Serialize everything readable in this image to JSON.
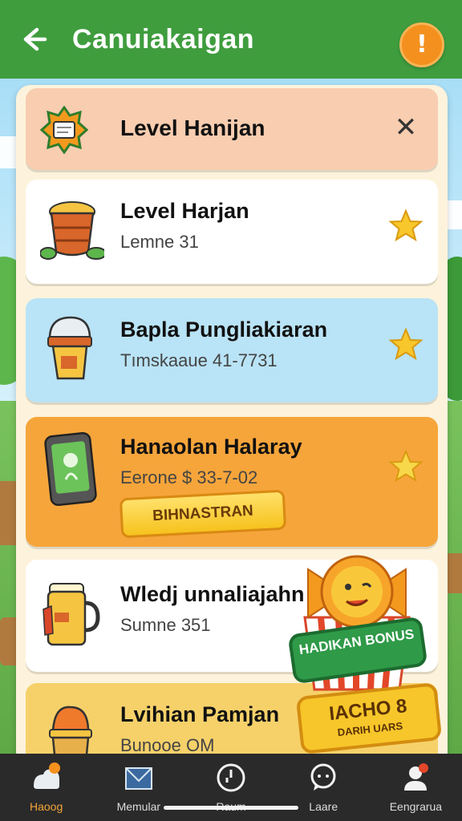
{
  "header": {
    "title": "Canuiakaigan",
    "back_icon": "arrow-left-icon",
    "help_symbol": "!"
  },
  "top_card": {
    "title": "Level Hanijan",
    "close_symbol": "✕"
  },
  "cards": [
    {
      "title": "Level Harjan",
      "subtitle": "Lemne 31",
      "color": "#ffffff",
      "icon": "bucket-icon"
    },
    {
      "title": "Bapla Pungliakiaran",
      "subtitle": "Tımskaaue 41-7731",
      "color": "#b9e3f6",
      "icon": "ice-cream-cup-icon"
    },
    {
      "title": "Hanaolan Halaray",
      "subtitle": "Eerone $ 33-7-02",
      "color": "#f6a53b",
      "icon": "phone-icon",
      "button_label": "BIHNASTRAN"
    },
    {
      "title": "Wledj unnaliajahn",
      "subtitle": "Sumne 351",
      "color": "#ffffff",
      "icon": "beer-mug-icon"
    },
    {
      "title": "Lvihian Pamjan",
      "subtitle": "Bunooe OM",
      "color": "#f6d16a",
      "icon": "cupcake-icon"
    }
  ],
  "bonus": {
    "badge_label": "HADIKAN BONUS",
    "tag_title": "IACHO 8",
    "tag_sub": "DARIH UARS"
  },
  "nav": [
    {
      "label": "Haoog",
      "icon": "home-icon",
      "active": true
    },
    {
      "label": "Memular",
      "icon": "envelope-icon",
      "active": false
    },
    {
      "label": "Raum",
      "icon": "timer-icon",
      "active": false
    },
    {
      "label": "Laare",
      "icon": "chat-icon",
      "active": false
    },
    {
      "label": "Eengrarua",
      "icon": "profile-icon",
      "active": false
    }
  ],
  "colors": {
    "header": "#3f9d3e",
    "accent": "#f4901e",
    "star": "#f7c72b"
  }
}
